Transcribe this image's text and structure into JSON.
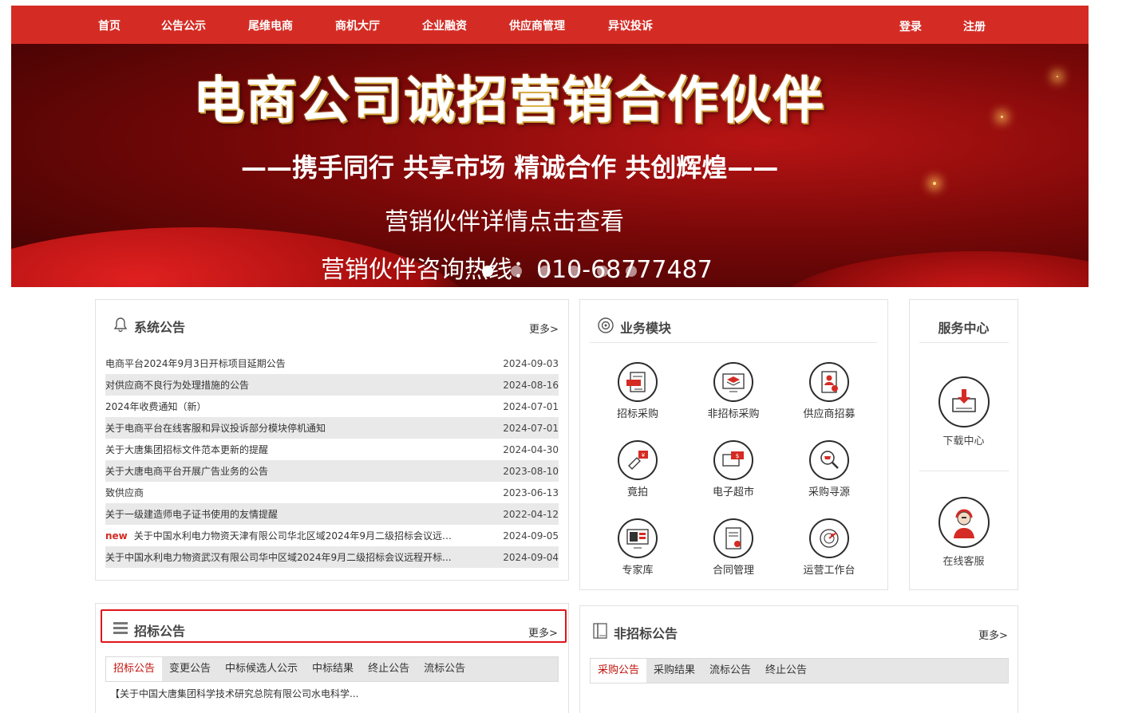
{
  "nav": {
    "items": [
      "首页",
      "公告公示",
      "尾维电商",
      "商机大厅",
      "企业融资",
      "供应商管理",
      "异议投诉"
    ],
    "login": "登录",
    "register": "注册"
  },
  "banner": {
    "headline": "电商公司诚招营销合作伙伴",
    "slogan": "——携手同行 共享市场 精诚合作 共创辉煌——",
    "details": "营销伙伴详情点击查看",
    "hotline": "营销伙伴咨询热线：010-68777487",
    "slide_count": 6,
    "active_slide": 1
  },
  "system_notice": {
    "title": "系统公告",
    "more": "更多>",
    "items": [
      {
        "title": "电商平台2024年9月3日开标项目延期公告",
        "date": "2024-09-03",
        "new": ""
      },
      {
        "title": "对供应商不良行为处理措施的公告",
        "date": "2024-08-16",
        "new": ""
      },
      {
        "title": "2024年收费通知（新）",
        "date": "2024-07-01",
        "new": ""
      },
      {
        "title": "关于电商平台在线客服和异议投诉部分模块停机通知",
        "date": "2024-07-01",
        "new": ""
      },
      {
        "title": "关于大唐集团招标文件范本更新的提醒",
        "date": "2024-04-30",
        "new": ""
      },
      {
        "title": "关于大唐电商平台开展广告业务的公告",
        "date": "2023-08-10",
        "new": ""
      },
      {
        "title": "致供应商",
        "date": "2023-06-13",
        "new": ""
      },
      {
        "title": "关于一级建造师电子证书使用的友情提醒",
        "date": "2022-04-12",
        "new": ""
      },
      {
        "title": "关于中国水利电力物资天津有限公司华北区域2024年9月二级招标会议远程...",
        "date": "2024-09-05",
        "new": "new"
      },
      {
        "title": "关于中国水利电力物资武汉有限公司华中区域2024年9月二级招标会议远程开标...",
        "date": "2024-09-04",
        "new": ""
      }
    ]
  },
  "business": {
    "title": "业务模块",
    "items": [
      "招标采购",
      "非招标采购",
      "供应商招募",
      "竟拍",
      "电子超市",
      "采购寻源",
      "专家库",
      "合同管理",
      "运营工作台"
    ]
  },
  "service": {
    "title": "服务中心",
    "items": [
      "下载中心",
      "在线客服"
    ]
  },
  "tender": {
    "title": "招标公告",
    "more": "更多>",
    "tabs": [
      "招标公告",
      "变更公告",
      "中标候选人公示",
      "中标结果",
      "终止公告",
      "流标公告"
    ],
    "first_item": "【关于中国大唐集团科学技术研究总院有限公司水电科学..."
  },
  "nontender": {
    "title": "非招标公告",
    "more": "更多>",
    "tabs": [
      "采购公告",
      "采购结果",
      "流标公告",
      "终止公告"
    ]
  },
  "colors": {
    "brand_red": "#d42c24",
    "highlight_border": "#e0151c"
  }
}
